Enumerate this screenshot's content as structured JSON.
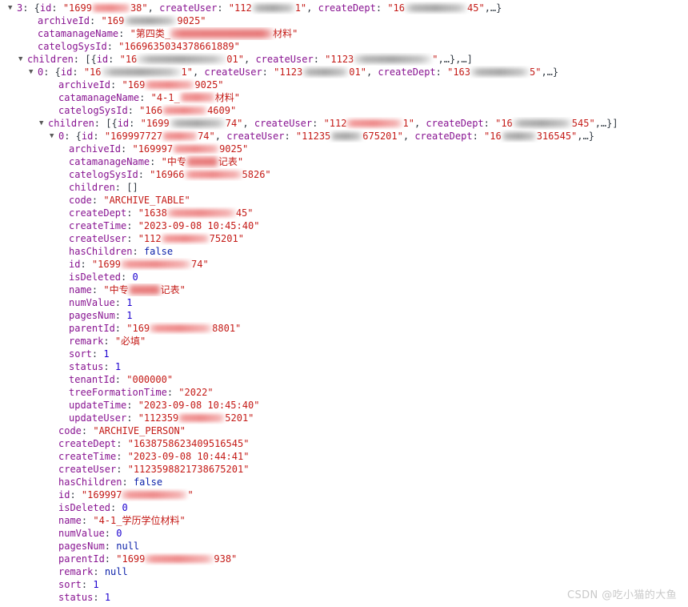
{
  "view": {
    "kind": "devtools-console-object-tree",
    "background": "#ffffff",
    "colors": {
      "key": "#881391",
      "string": "#c41a16",
      "number": "#1c00cf",
      "boolean": "#0d22aa",
      "null": "#0d22aa",
      "punctuation": "#303942",
      "triangle": "#5a5a5a",
      "watermark": "#c9c9c9",
      "redaction_pink": "#ee8c8c",
      "redaction_grey": "#a6a6a6"
    },
    "watermark": "CSDN @吃小猫的大鱼"
  },
  "tokens": {
    "colon": ":",
    "quote": "\"",
    "comma": ",",
    "ellipsis": "…",
    "brace_open": "{",
    "brace_close": "}",
    "bracket_open": "[",
    "bracket_close": "]",
    "empty_array": "[]",
    "triangle_open": "▼"
  },
  "keys": {
    "archiveId": "archiveId",
    "catamanageName": "catamanageName",
    "catelogSysId": "catelogSysId",
    "children": "children",
    "code": "code",
    "createDept": "createDept",
    "createTime": "createTime",
    "createUser": "createUser",
    "hasChildren": "hasChildren",
    "id": "id",
    "isDeleted": "isDeleted",
    "name": "name",
    "numValue": "numValue",
    "pagesNum": "pagesNum",
    "parentId": "parentId",
    "remark": "remark",
    "sort": "sort",
    "status": "status",
    "tenantId": "tenantId",
    "treeFormationTime": "treeFormationTime",
    "updateTime": "updateTime",
    "updateUser": "updateUser"
  },
  "lines": [
    {
      "n": 1,
      "level": 0,
      "expandable": true,
      "expanded": true,
      "label": "3",
      "summary_prefix": "{id: \"1699",
      "summary_tail": "38\", createUser: \"112",
      "text_fragments": [
        "3:",
        "{id:",
        "\"1699",
        "38\",",
        "createUser:",
        "\"112",
        "1\",",
        "createDept:",
        "\"16",
        "45\",",
        "…}"
      ]
    },
    {
      "n": 2,
      "level": 1,
      "key": "archiveId",
      "value_visible_start": "\"169",
      "value_visible_end": "9025\"",
      "type": "string"
    },
    {
      "n": 3,
      "level": 1,
      "key": "catamanageName",
      "value_visible_start": "\"第四类_",
      "value_visible_end": "材料\"",
      "type": "string"
    },
    {
      "n": 4,
      "level": 1,
      "key": "catelogSysId",
      "value": "\"1669635034378661889\"",
      "type": "string"
    },
    {
      "n": 5,
      "level": 1,
      "key": "children",
      "expandable": true,
      "expanded": true,
      "value_preview": "[{id: \"16 … 01\", createUser: \"1123 … \",…},…]",
      "type": "array"
    },
    {
      "n": 6,
      "level": 2,
      "label": "0",
      "expandable": true,
      "expanded": true,
      "value_preview": "{id: \"16 … 1\", createUser: \"1123 … 01\", createDept: \"163 … 5\",…}",
      "type": "object"
    },
    {
      "n": 7,
      "level": 3,
      "key": "archiveId",
      "value_visible_start": "\"169",
      "value_visible_end": "9025\"",
      "type": "string"
    },
    {
      "n": 8,
      "level": 3,
      "key": "catamanageName",
      "value_visible_start": "\"4-1_",
      "value_visible_end": "材料\"",
      "type": "string"
    },
    {
      "n": 9,
      "level": 3,
      "key": "catelogSysId",
      "value_visible_start": "\"166",
      "value_visible_end": "4609\"",
      "type": "string"
    },
    {
      "n": 10,
      "level": 3,
      "key": "children",
      "expandable": true,
      "expanded": true,
      "value_preview": "[{id: \"1699 … 74\", createUser: \"112 … 1\", createDept: \"16 … 545\",…}]",
      "type": "array"
    },
    {
      "n": 11,
      "level": 4,
      "label": "0",
      "expandable": true,
      "expanded": true,
      "value_preview": "{id: \"169997727 … 74\", createUser: \"11235 … 675201\", createDept: \"16 … 316545\",…}",
      "type": "object"
    },
    {
      "n": 12,
      "level": 5,
      "key": "archiveId",
      "value_visible_start": "\"169997",
      "value_visible_end": "9025\"",
      "type": "string"
    },
    {
      "n": 13,
      "level": 5,
      "key": "catamanageName",
      "value_visible_start": "\"中专",
      "value_visible_end": "记表\"",
      "type": "string"
    },
    {
      "n": 14,
      "level": 5,
      "key": "catelogSysId",
      "value_visible_start": "\"16966",
      "value_visible_end": "5826\"",
      "type": "string"
    },
    {
      "n": 15,
      "level": 5,
      "key": "children",
      "value": "[]",
      "type": "array"
    },
    {
      "n": 16,
      "level": 5,
      "key": "code",
      "value": "\"ARCHIVE_TABLE\"",
      "type": "string"
    },
    {
      "n": 17,
      "level": 5,
      "key": "createDept",
      "value_visible_start": "\"1638",
      "value_visible_end": "45\"",
      "type": "string"
    },
    {
      "n": 18,
      "level": 5,
      "key": "createTime",
      "value": "\"2023-09-08 10:45:40\"",
      "type": "string"
    },
    {
      "n": 19,
      "level": 5,
      "key": "createUser",
      "value_visible_start": "\"112",
      "value_visible_end": "75201\"",
      "type": "string"
    },
    {
      "n": 20,
      "level": 5,
      "key": "hasChildren",
      "value": "false",
      "type": "boolean"
    },
    {
      "n": 21,
      "level": 5,
      "key": "id",
      "value_visible_start": "\"1699",
      "value_visible_end": "74\"",
      "type": "string"
    },
    {
      "n": 22,
      "level": 5,
      "key": "isDeleted",
      "value": "0",
      "type": "number"
    },
    {
      "n": 23,
      "level": 5,
      "key": "name",
      "value_visible_start": "\"中专",
      "value_visible_end": "记表\"",
      "type": "string"
    },
    {
      "n": 24,
      "level": 5,
      "key": "numValue",
      "value": "1",
      "type": "number"
    },
    {
      "n": 25,
      "level": 5,
      "key": "pagesNum",
      "value": "1",
      "type": "number"
    },
    {
      "n": 26,
      "level": 5,
      "key": "parentId",
      "value_visible_start": "\"169",
      "value_visible_end": "8801\"",
      "type": "string"
    },
    {
      "n": 27,
      "level": 5,
      "key": "remark",
      "value": "\"必填\"",
      "type": "string"
    },
    {
      "n": 28,
      "level": 5,
      "key": "sort",
      "value": "1",
      "type": "number"
    },
    {
      "n": 29,
      "level": 5,
      "key": "status",
      "value": "1",
      "type": "number"
    },
    {
      "n": 30,
      "level": 5,
      "key": "tenantId",
      "value": "\"000000\"",
      "type": "string"
    },
    {
      "n": 31,
      "level": 5,
      "key": "treeFormationTime",
      "value": "\"2022\"",
      "type": "string"
    },
    {
      "n": 32,
      "level": 5,
      "key": "updateTime",
      "value": "\"2023-09-08 10:45:40\"",
      "type": "string"
    },
    {
      "n": 33,
      "level": 5,
      "key": "updateUser",
      "value_visible_start": "\"112359",
      "value_visible_end": "5201\"",
      "type": "string"
    },
    {
      "n": 34,
      "level": 3,
      "key": "code",
      "value": "\"ARCHIVE_PERSON\"",
      "type": "string"
    },
    {
      "n": 35,
      "level": 3,
      "key": "createDept",
      "value": "\"1638758623409516545\"",
      "type": "string"
    },
    {
      "n": 36,
      "level": 3,
      "key": "createTime",
      "value": "\"2023-09-08 10:44:41\"",
      "type": "string"
    },
    {
      "n": 37,
      "level": 3,
      "key": "createUser",
      "value": "\"1123598821738675201\"",
      "type": "string"
    },
    {
      "n": 38,
      "level": 3,
      "key": "hasChildren",
      "value": "false",
      "type": "boolean"
    },
    {
      "n": 39,
      "level": 3,
      "key": "id",
      "value_visible_start": "\"169997",
      "value_visible_end": "\"",
      "type": "string"
    },
    {
      "n": 40,
      "level": 3,
      "key": "isDeleted",
      "value": "0",
      "type": "number"
    },
    {
      "n": 41,
      "level": 3,
      "key": "name",
      "value": "\"4-1_学历学位材料\"",
      "type": "string"
    },
    {
      "n": 42,
      "level": 3,
      "key": "numValue",
      "value": "0",
      "type": "number"
    },
    {
      "n": 43,
      "level": 3,
      "key": "pagesNum",
      "value": "null",
      "type": "null"
    },
    {
      "n": 44,
      "level": 3,
      "key": "parentId",
      "value_visible_start": "\"1699",
      "value_visible_end": "938\"",
      "type": "string"
    },
    {
      "n": 45,
      "level": 3,
      "key": "remark",
      "value": "null",
      "type": "null"
    },
    {
      "n": 46,
      "level": 3,
      "key": "sort",
      "value": "1",
      "type": "number"
    },
    {
      "n": 47,
      "level": 3,
      "key": "status",
      "value": "1",
      "type": "number"
    }
  ],
  "row_text": {
    "r1_a": "3",
    "r1_b": ": {",
    "r1_id_key": "id",
    "r1_id_val_a": "\"1699",
    "r1_id_val_b": "38\"",
    "r1_cu_key": "createUser",
    "r1_cu_val_a": "\"112",
    "r1_cu_val_b": "1\"",
    "r1_cd_key": "createDept",
    "r1_cd_val_a": "\"16",
    "r1_cd_val_b": "45\"",
    "r1_end": ",…}",
    "r2_key": "archiveId",
    "r2_val_a": "\"169",
    "r2_val_b": "9025\"",
    "r3_key": "catamanageName",
    "r3_val_a": "\"第四类_",
    "r3_val_b": "材料\"",
    "r4_key": "catelogSysId",
    "r4_val": "\"1669635034378661889\"",
    "r5_key": "children",
    "r5_a": ": [{",
    "r5_id_key": "id",
    "r5_id_val_a": "\"16",
    "r5_id_val_b": "01\"",
    "r5_cu_key": "createUser",
    "r5_cu_val_a": "\"1123",
    "r5_cu_val_b": "\"",
    "r5_end": ",…},…]",
    "r6_label": "0",
    "r6_a": ": {",
    "r6_id_key": "id",
    "r6_id_val_a": "\"16",
    "r6_id_val_b": "1\"",
    "r6_cu_key": "createUser",
    "r6_cu_val_a": "\"1123",
    "r6_cu_val_b": "01\"",
    "r6_cd_key": "createDept",
    "r6_cd_val_a": "\"163",
    "r6_cd_val_b": "5\"",
    "r6_end": ",…}",
    "r7_key": "archiveId",
    "r7_val_a": "\"169",
    "r7_val_b": "9025\"",
    "r8_key": "catamanageName",
    "r8_val_a": "\"4-1_",
    "r8_val_b": "材料\"",
    "r9_key": "catelogSysId",
    "r9_val_a": "\"166",
    "r9_val_b": "4609\"",
    "r10_key": "children",
    "r10_a": ": [{",
    "r10_id_key": "id",
    "r10_id_val_a": "\"1699",
    "r10_id_val_b": "74\"",
    "r10_cu_key": "createUser",
    "r10_cu_val_a": "\"112",
    "r10_cu_val_b": "1\"",
    "r10_cd_key": "createDept",
    "r10_cd_val_a": "\"16",
    "r10_cd_val_b": "545\"",
    "r10_end": ",…}]",
    "r11_label": "0",
    "r11_a": ": {",
    "r11_id_key": "id",
    "r11_id_val_a": "\"169997727",
    "r11_id_val_b": "74\"",
    "r11_cu_key": "createUser",
    "r11_cu_val_a": "\"11235",
    "r11_cu_val_b": "675201\"",
    "r11_cd_key": "createDept",
    "r11_cd_val_a": "\"16",
    "r11_cd_val_b": "316545\"",
    "r11_end": ",…}",
    "r12_key": "archiveId",
    "r12_val_a": "\"169997",
    "r12_val_b": "9025\"",
    "r13_key": "catamanageName",
    "r13_val_a": "\"中专",
    "r13_val_b": "记表\"",
    "r14_key": "catelogSysId",
    "r14_val_a": "\"16966",
    "r14_val_b": "5826\"",
    "r15_key": "children",
    "r15_val": "[]",
    "r16_key": "code",
    "r16_val": "\"ARCHIVE_TABLE\"",
    "r17_key": "createDept",
    "r17_val_a": "\"1638",
    "r17_val_b": "45\"",
    "r18_key": "createTime",
    "r18_val": "\"2023-09-08 10:45:40\"",
    "r19_key": "createUser",
    "r19_val_a": "\"112",
    "r19_val_b": "75201\"",
    "r20_key": "hasChildren",
    "r20_val": "false",
    "r21_key": "id",
    "r21_val_a": "\"1699",
    "r21_val_b": "74\"",
    "r22_key": "isDeleted",
    "r22_val": "0",
    "r23_key": "name",
    "r23_val_a": "\"中专",
    "r23_val_b": "记表\"",
    "r24_key": "numValue",
    "r24_val": "1",
    "r25_key": "pagesNum",
    "r25_val": "1",
    "r26_key": "parentId",
    "r26_val_a": "\"169",
    "r26_val_b": "8801\"",
    "r27_key": "remark",
    "r27_val": "\"必填\"",
    "r28_key": "sort",
    "r28_val": "1",
    "r29_key": "status",
    "r29_val": "1",
    "r30_key": "tenantId",
    "r30_val": "\"000000\"",
    "r31_key": "treeFormationTime",
    "r31_val": "\"2022\"",
    "r32_key": "updateTime",
    "r32_val": "\"2023-09-08 10:45:40\"",
    "r33_key": "updateUser",
    "r33_val_a": "\"112359",
    "r33_val_b": "5201\"",
    "r34_key": "code",
    "r34_val": "\"ARCHIVE_PERSON\"",
    "r35_key": "createDept",
    "r35_val": "\"1638758623409516545\"",
    "r36_key": "createTime",
    "r36_val": "\"2023-09-08 10:44:41\"",
    "r37_key": "createUser",
    "r37_val": "\"1123598821738675201\"",
    "r38_key": "hasChildren",
    "r38_val": "false",
    "r39_key": "id",
    "r39_val_a": "\"169997",
    "r39_val_b": "\"",
    "r40_key": "isDeleted",
    "r40_val": "0",
    "r41_key": "name",
    "r41_val": "\"4-1_学历学位材料\"",
    "r42_key": "numValue",
    "r42_val": "0",
    "r43_key": "pagesNum",
    "r43_val": "null",
    "r44_key": "parentId",
    "r44_val_a": "\"1699",
    "r44_val_b": "938\"",
    "r45_key": "remark",
    "r45_val": "null",
    "r46_key": "sort",
    "r46_val": "1",
    "r47_key": "status",
    "r47_val": "1"
  }
}
